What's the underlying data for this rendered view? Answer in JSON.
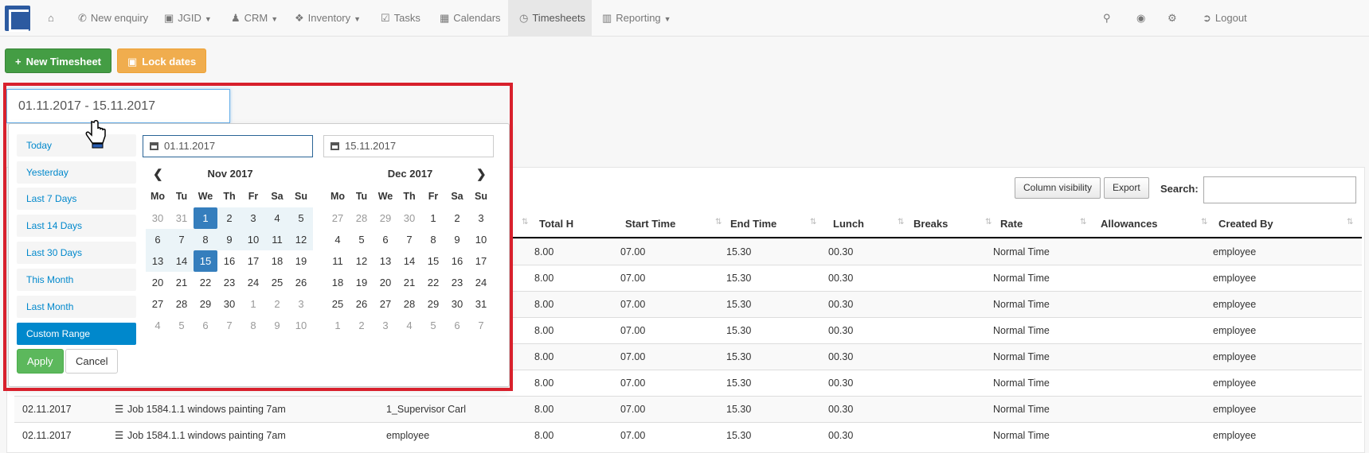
{
  "nav": {
    "items": [
      {
        "label": "",
        "icon": "home-icon"
      },
      {
        "label": "New enquiry",
        "icon": "phone-icon"
      },
      {
        "label": "JGID",
        "icon": "jgid-icon",
        "caret": true
      },
      {
        "label": "CRM",
        "icon": "users-icon",
        "caret": true
      },
      {
        "label": "Inventory",
        "icon": "cubes-icon",
        "caret": true
      },
      {
        "label": "Tasks",
        "icon": "check-icon"
      },
      {
        "label": "Calendars",
        "icon": "calendar-icon"
      },
      {
        "label": "Timesheets",
        "icon": "clock-icon",
        "active": true
      },
      {
        "label": "Reporting",
        "icon": "bar-chart-icon",
        "caret": true
      }
    ],
    "right": [
      {
        "label": "",
        "icon": "search-icon"
      },
      {
        "label": "",
        "icon": "globe-icon"
      },
      {
        "label": "",
        "icon": "cogs-icon"
      },
      {
        "label": "Logout",
        "icon": "logout-icon"
      }
    ]
  },
  "toolbar": {
    "new_label": "New Timesheet",
    "lock_label": "Lock dates"
  },
  "picker": {
    "value": "01.11.2017 - 15.11.2017",
    "ranges": [
      "Today",
      "Yesterday",
      "Last 7 Days",
      "Last 14 Days",
      "Last 30 Days",
      "This Month",
      "Last Month",
      "Custom Range"
    ],
    "active_range": "Custom Range",
    "apply_label": "Apply",
    "cancel_label": "Cancel",
    "start_input": "01.11.2017",
    "end_input": "15.11.2017",
    "weekdays": [
      "Mo",
      "Tu",
      "We",
      "Th",
      "Fr",
      "Sa",
      "Su"
    ],
    "left_month": "Nov 2017",
    "right_month": "Dec 2017",
    "left_days": [
      [
        "30",
        "31",
        "1",
        "2",
        "3",
        "4",
        "5"
      ],
      [
        "6",
        "7",
        "8",
        "9",
        "10",
        "11",
        "12"
      ],
      [
        "13",
        "14",
        "15",
        "16",
        "17",
        "18",
        "19"
      ],
      [
        "20",
        "21",
        "22",
        "23",
        "24",
        "25",
        "26"
      ],
      [
        "27",
        "28",
        "29",
        "30",
        "1",
        "2",
        "3"
      ],
      [
        "4",
        "5",
        "6",
        "7",
        "8",
        "9",
        "10"
      ]
    ],
    "right_days": [
      [
        "27",
        "28",
        "29",
        "30",
        "1",
        "2",
        "3"
      ],
      [
        "4",
        "5",
        "6",
        "7",
        "8",
        "9",
        "10"
      ],
      [
        "11",
        "12",
        "13",
        "14",
        "15",
        "16",
        "17"
      ],
      [
        "18",
        "19",
        "20",
        "21",
        "22",
        "23",
        "24"
      ],
      [
        "25",
        "26",
        "27",
        "28",
        "29",
        "30",
        "31"
      ],
      [
        "1",
        "2",
        "3",
        "4",
        "5",
        "6",
        "7"
      ]
    ]
  },
  "table": {
    "column_visibility_label": "Column visibility",
    "export_label": "Export",
    "search_label": "Search:",
    "headers": [
      "Total H",
      "Start Time",
      "End Time",
      "Lunch",
      "Breaks",
      "Rate",
      "Allowances",
      "Created By"
    ],
    "rows": [
      {
        "date": "",
        "job": "",
        "employee": "",
        "total": "8.00",
        "start": "07.00",
        "end": "15.30",
        "lunch": "00.30",
        "rate": "Normal Time",
        "created": "employee"
      },
      {
        "date": "",
        "job": "",
        "employee": "",
        "total": "8.00",
        "start": "07.00",
        "end": "15.30",
        "lunch": "00.30",
        "rate": "Normal Time",
        "created": "employee"
      },
      {
        "date": "",
        "job": "",
        "employee": "",
        "total": "8.00",
        "start": "07.00",
        "end": "15.30",
        "lunch": "00.30",
        "rate": "Normal Time",
        "created": "employee"
      },
      {
        "date": "",
        "job": "",
        "employee": "",
        "total": "8.00",
        "start": "07.00",
        "end": "15.30",
        "lunch": "00.30",
        "rate": "Normal Time",
        "created": "employee"
      },
      {
        "date": "",
        "job": "",
        "employee": "",
        "total": "8.00",
        "start": "07.00",
        "end": "15.30",
        "lunch": "00.30",
        "rate": "Normal Time",
        "created": "employee"
      },
      {
        "date": "",
        "job": "",
        "employee": "",
        "total": "8.00",
        "start": "07.00",
        "end": "15.30",
        "lunch": "00.30",
        "rate": "Normal Time",
        "created": "employee"
      },
      {
        "date": "02.11.2017",
        "job": "Job 1584.1.1 windows painting 7am",
        "employee": "1_Supervisor Carl",
        "total": "8.00",
        "start": "07.00",
        "end": "15.30",
        "lunch": "00.30",
        "rate": "Normal Time",
        "created": "employee"
      },
      {
        "date": "02.11.2017",
        "job": "Job 1584.1.1 windows painting 7am",
        "employee": "employee",
        "total": "8.00",
        "start": "07.00",
        "end": "15.30",
        "lunch": "00.30",
        "rate": "Normal Time",
        "created": "employee"
      }
    ]
  }
}
